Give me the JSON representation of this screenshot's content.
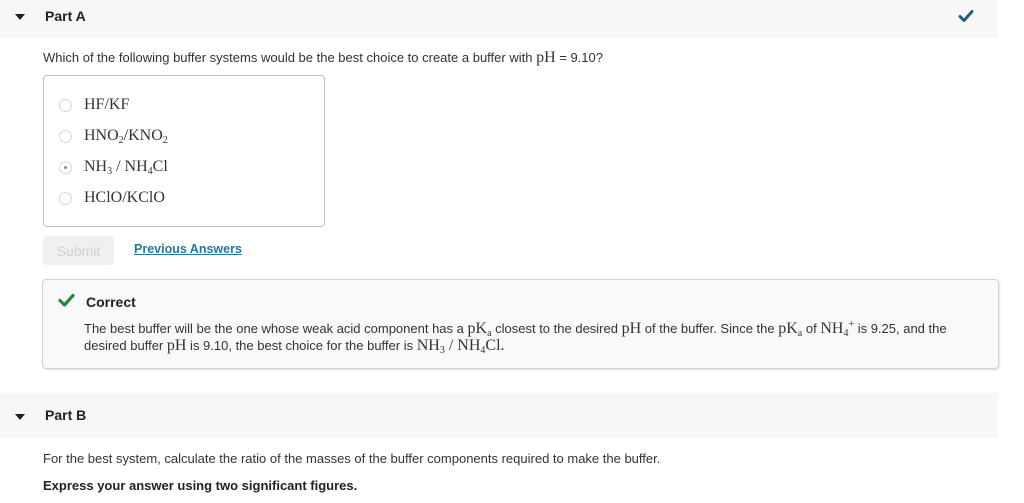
{
  "partA": {
    "title": "Part A",
    "status": "check-icon",
    "question_prefix": "Which of the following buffer systems would be the best choice to create a buffer with ",
    "question_math": "pH",
    "question_suffix": " = 9.10?",
    "choices": [
      {
        "label_html": "HF/KF",
        "selected": false
      },
      {
        "label_html": "HNO<sub>2</sub>/KNO<sub>2</sub>",
        "selected": false
      },
      {
        "label_html": "NH<sub>3</sub> / NH<sub>4</sub>Cl",
        "selected": true
      },
      {
        "label_html": "HClO/KClO",
        "selected": false
      }
    ],
    "submit_label": "Submit",
    "previous_answers_label": "Previous Answers",
    "feedback": {
      "title": "Correct",
      "text_parts": {
        "t1": "The best buffer will be the one whose weak acid component has a ",
        "m_pKa": "pK",
        "m_a": "a",
        "t2": " closest to the desired ",
        "m_pH": "pH",
        "t3": " of the buffer. Since the ",
        "t4": " of ",
        "m_NH4": "NH",
        "m_4": "4",
        "m_plus": "+",
        "t5": " is 9.25, and the desired buffer ",
        "t6": " is 9.10, the best choice for the buffer is ",
        "m_answer_a": "NH",
        "m_3": "3",
        "m_slash": " / ",
        "m_answer_b": "NH",
        "m_cl": "Cl",
        "t7": "."
      }
    }
  },
  "partB": {
    "title": "Part B",
    "text": "For the best system, calculate the ratio of the masses of the buffer components required to make the buffer.",
    "instruction": "Express your answer using two significant figures."
  },
  "colors": {
    "check_partA": "#1c6179",
    "check_correct": "#1e8e3e",
    "link": "#1f7aa0"
  }
}
